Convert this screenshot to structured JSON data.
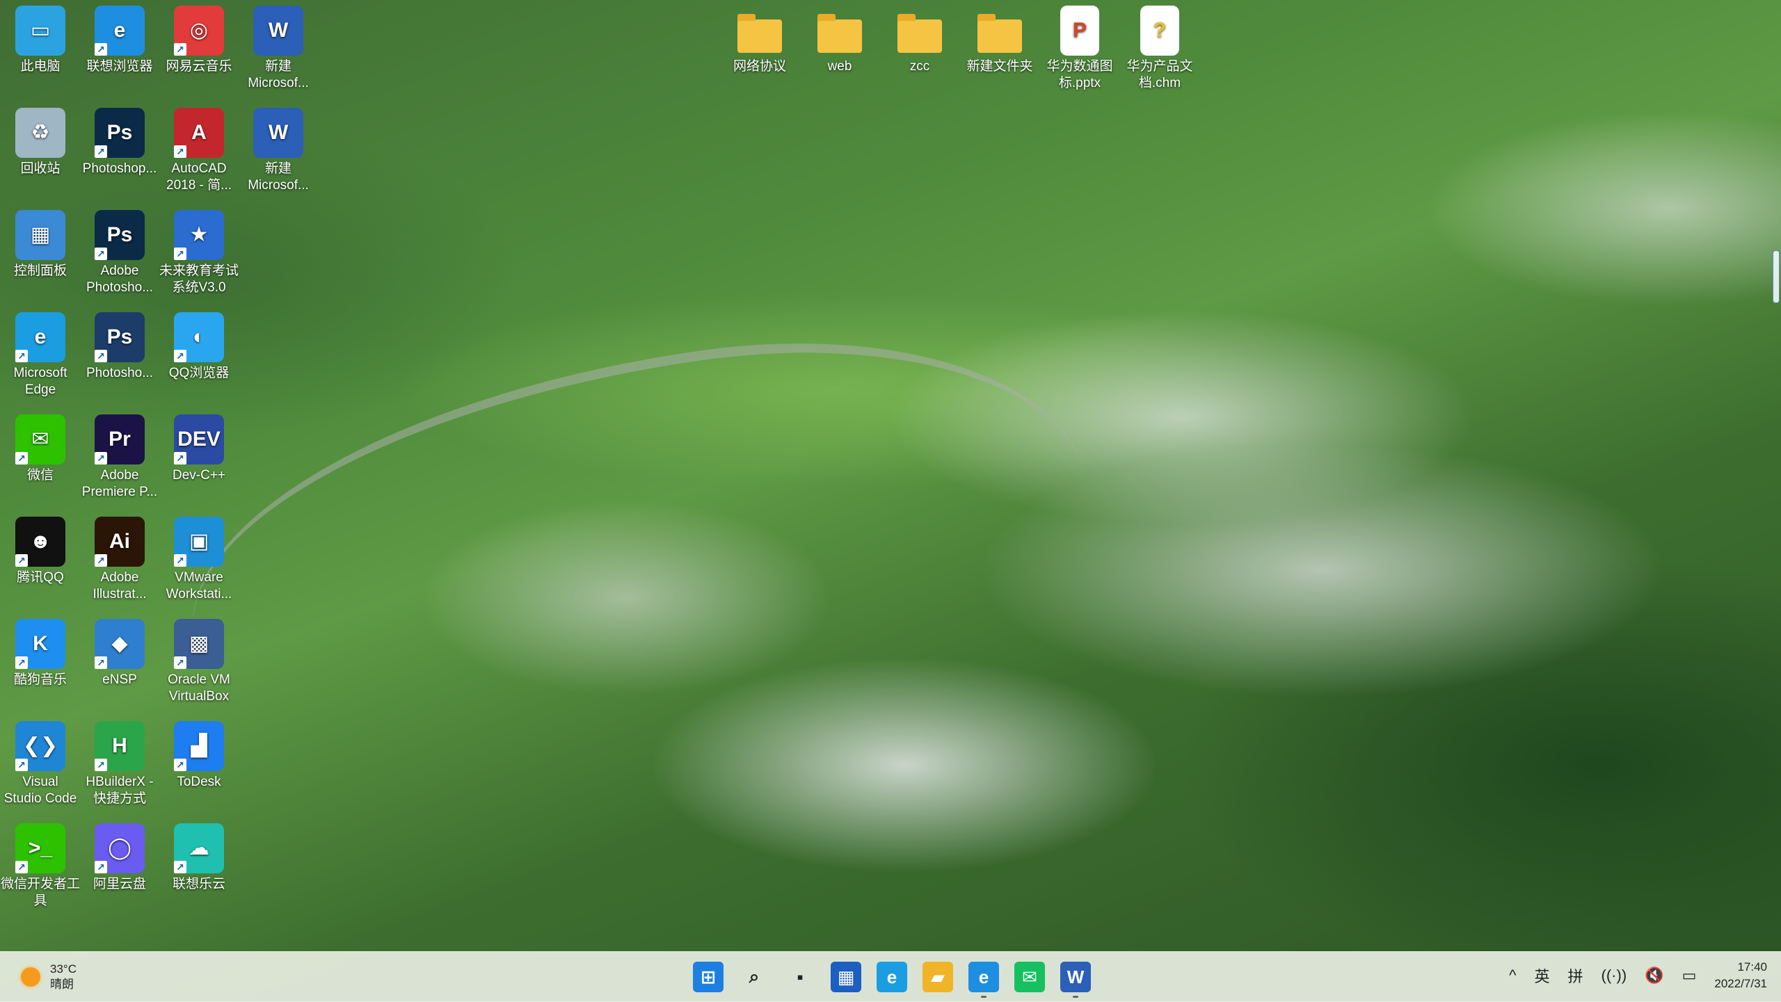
{
  "desktop": {
    "icons_left": [
      {
        "label": "此电脑",
        "icon": "this-pc-icon",
        "color": "#2ba3e0",
        "glyph": "▭",
        "shortcut": false
      },
      {
        "label": "联想浏览器",
        "icon": "lenovo-browser-icon",
        "color": "#1e8fe0",
        "glyph": "e",
        "shortcut": true
      },
      {
        "label": "网易云音乐",
        "icon": "netease-music-icon",
        "color": "#e23b3b",
        "glyph": "◎",
        "shortcut": true
      },
      {
        "label": "新建\nMicrosof...",
        "icon": "word-doc-icon",
        "color": "#2b5fb8",
        "glyph": "W",
        "shortcut": false
      },
      {
        "label": "回收站",
        "icon": "recycle-bin-icon",
        "color": "#9fb6c4",
        "glyph": "♻",
        "shortcut": false
      },
      {
        "label": "Photoshop...",
        "icon": "photoshop-icon",
        "color": "#0b2a48",
        "glyph": "Ps",
        "shortcut": true
      },
      {
        "label": "AutoCAD\n2018 - 简...",
        "icon": "autocad-icon",
        "color": "#c4262e",
        "glyph": "A",
        "shortcut": true
      },
      {
        "label": "新建\nMicrosof...",
        "icon": "word-doc-icon",
        "color": "#2b5fb8",
        "glyph": "W",
        "shortcut": false
      },
      {
        "label": "控制面板",
        "icon": "control-panel-icon",
        "color": "#3b8ad6",
        "glyph": "▦",
        "shortcut": false
      },
      {
        "label": "Adobe\nPhotosho...",
        "icon": "photoshop-icon",
        "color": "#0b2a48",
        "glyph": "Ps",
        "shortcut": true
      },
      {
        "label": "未来教育考试\n系统V3.0",
        "icon": "exam-system-icon",
        "color": "#2a6ccf",
        "glyph": "★",
        "shortcut": true
      },
      {
        "label": "Microsoft\nEdge",
        "icon": "edge-icon",
        "color": "#1b9de2",
        "glyph": "e",
        "shortcut": true
      },
      {
        "label": "Photosho...",
        "icon": "photoshop-icon",
        "color": "#1c3c6a",
        "glyph": "Ps",
        "shortcut": true
      },
      {
        "label": "QQ浏览器",
        "icon": "qq-browser-icon",
        "color": "#2aa6f0",
        "glyph": "◐",
        "shortcut": true
      },
      {
        "label": "微信",
        "icon": "wechat-icon",
        "color": "#2dc100",
        "glyph": "✉",
        "shortcut": true
      },
      {
        "label": "Adobe\nPremiere P...",
        "icon": "premiere-icon",
        "color": "#1b1346",
        "glyph": "Pr",
        "shortcut": true
      },
      {
        "label": "Dev-C++",
        "icon": "devcpp-icon",
        "color": "#2b4aa3",
        "glyph": "DEV",
        "shortcut": true
      },
      {
        "label": "腾讯QQ",
        "icon": "qq-icon",
        "color": "#111111",
        "glyph": "☻",
        "shortcut": true
      },
      {
        "label": "Adobe\nIllustrat...",
        "icon": "illustrator-icon",
        "color": "#2a1506",
        "glyph": "Ai",
        "shortcut": true
      },
      {
        "label": "VMware\nWorkstati...",
        "icon": "vmware-icon",
        "color": "#1d8fd6",
        "glyph": "▣",
        "shortcut": true
      },
      {
        "label": "酷狗音乐",
        "icon": "kugou-icon",
        "color": "#1e8ff0",
        "glyph": "K",
        "shortcut": true
      },
      {
        "label": "eNSP",
        "icon": "ensp-icon",
        "color": "#2f7fd0",
        "glyph": "◆",
        "shortcut": true
      },
      {
        "label": "Oracle VM\nVirtualBox",
        "icon": "virtualbox-icon",
        "color": "#3b5e94",
        "glyph": "▩",
        "shortcut": true
      },
      {
        "label": "Visual\nStudio Code",
        "icon": "vscode-icon",
        "color": "#1f86d6",
        "glyph": "❮❯",
        "shortcut": true
      },
      {
        "label": "HBuilderX -\n快捷方式",
        "icon": "hbuilderx-icon",
        "color": "#2aa54a",
        "glyph": "H",
        "shortcut": true
      },
      {
        "label": "ToDesk",
        "icon": "todesk-icon",
        "color": "#1e7df0",
        "glyph": "▟",
        "shortcut": true
      },
      {
        "label": "微信开发者工\n具",
        "icon": "wechat-devtools-icon",
        "color": "#2dc100",
        "glyph": ">_",
        "shortcut": true
      },
      {
        "label": "阿里云盘",
        "icon": "aliyun-drive-icon",
        "color": "#6a5cf0",
        "glyph": "◯",
        "shortcut": true
      },
      {
        "label": "联想乐云",
        "icon": "lenovo-cloud-icon",
        "color": "#1fc0b0",
        "glyph": "☁",
        "shortcut": true
      }
    ],
    "icons_top": [
      {
        "label": "网络协议",
        "icon": "folder-icon",
        "type": "folder"
      },
      {
        "label": "web",
        "icon": "folder-icon",
        "type": "folder"
      },
      {
        "label": "zcc",
        "icon": "folder-icon",
        "type": "folder"
      },
      {
        "label": "新建文件夹",
        "icon": "folder-icon",
        "type": "folder"
      },
      {
        "label": "华为数通图\n标.pptx",
        "icon": "pptx-file-icon",
        "type": "file",
        "color": "#d24726",
        "glyph": "P"
      },
      {
        "label": "华为产品文\n档.chm",
        "icon": "chm-file-icon",
        "type": "file",
        "color": "#e8c21a",
        "glyph": "?"
      }
    ]
  },
  "taskbar": {
    "weather": {
      "temp": "33°C",
      "desc": "晴朗",
      "icon": "sun-icon"
    },
    "apps": [
      {
        "name": "start-button",
        "glyph": "⊞",
        "color": "#1d7fe0",
        "open": false
      },
      {
        "name": "search-button",
        "glyph": "⌕",
        "color": "#222222",
        "open": false
      },
      {
        "name": "task-view-button",
        "glyph": "▪",
        "color": "#222222",
        "open": false
      },
      {
        "name": "store-icon",
        "glyph": "▦",
        "color": "#1d5fc0",
        "open": false
      },
      {
        "name": "edge-icon",
        "glyph": "e",
        "color": "#1b9de2",
        "open": false
      },
      {
        "name": "file-explorer-icon",
        "glyph": "▰",
        "color": "#f0b429",
        "open": false
      },
      {
        "name": "lenovo-browser-icon",
        "glyph": "e",
        "color": "#1e8fe0",
        "open": true
      },
      {
        "name": "messaging-icon",
        "glyph": "✉",
        "color": "#16c060",
        "open": false
      },
      {
        "name": "word-icon",
        "glyph": "W",
        "color": "#2b5fb8",
        "open": true
      }
    ],
    "tray": {
      "chevron": "^",
      "lang": "英",
      "ime": "拼",
      "time": "17:40",
      "date": "2022/7/31"
    }
  }
}
